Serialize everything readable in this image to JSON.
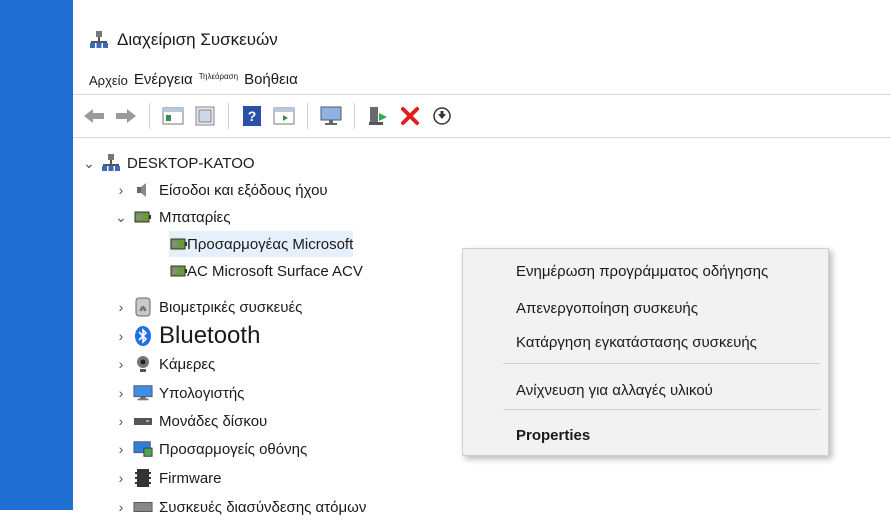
{
  "window": {
    "title": "Διαχείριση Συσκευών"
  },
  "menu": {
    "items": [
      "Αρχείο",
      "Ενέργεια",
      "Τηλεόραση",
      "Βοήθεια"
    ]
  },
  "toolbar": {
    "icons": [
      "back-arrow-icon",
      "forward-arrow-icon",
      "properties-icon",
      "driver-icon",
      "help-icon",
      "console-icon",
      "monitor-icon",
      "enable-device-icon",
      "uninstall-x-icon",
      "download-icon"
    ]
  },
  "tree": {
    "root": "DESKTOP-KATOO",
    "nodes": [
      "Είσοδοι και εξόδους ήχου",
      "Μπαταρίες",
      "Προσαρμογέας Microsoft",
      "AC Microsoft Surface ACV",
      "Βιομετρικές συσκευές",
      "Bluetooth",
      "Κάμερες",
      "Υπολογιστής",
      "Μονάδες δίσκου",
      "Προσαρμογείς οθόνης",
      "Firmware",
      "Συσκευές διασύνδεσης ατόμων"
    ]
  },
  "context_menu": {
    "update_driver": "Ενημέρωση προγράμματος οδήγησης",
    "disable_device": "Απενεργοποίηση συσκευής",
    "uninstall_device": "Κατάργηση εγκατάστασης συσκευής",
    "scan_hardware": "Ανίχνευση για αλλαγές υλικού",
    "properties": "Properties"
  },
  "colors": {
    "accent_bar": "#1f6fd3",
    "uninstall_red": "#e0201e"
  }
}
